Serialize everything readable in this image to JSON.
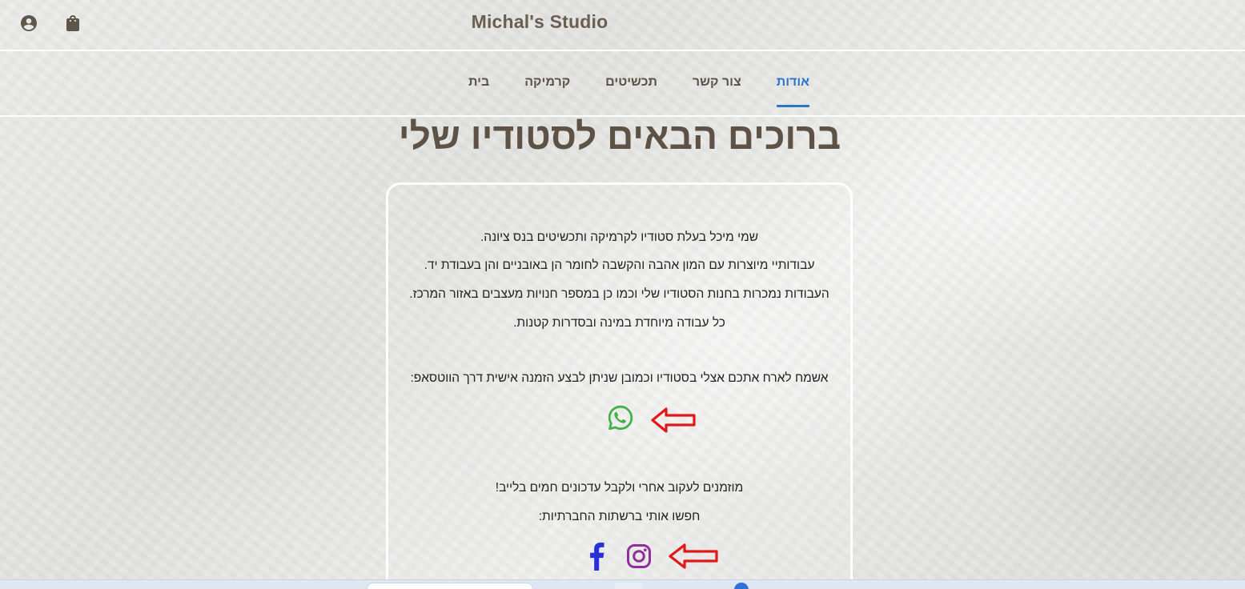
{
  "header": {
    "site_title": "Michal's Studio",
    "account_icon": "account-circle-icon",
    "cart_icon": "shopping-bag-icon"
  },
  "nav": {
    "items": [
      {
        "label": "בית",
        "active": false
      },
      {
        "label": "קרמיקה",
        "active": false
      },
      {
        "label": "תכשיטים",
        "active": false
      },
      {
        "label": "צור קשר",
        "active": false
      },
      {
        "label": "אודות",
        "active": true
      }
    ],
    "active_color": "#2e74c9"
  },
  "main": {
    "heading": "ברוכים הבאים לסטודיו שלי",
    "about_lines": [
      "שמי מיכל בעלת סטודיו לקרמיקה ותכשיטים בנס ציונה.",
      "עבודותיי מיוצרות עם המון אהבה והקשבה לחומר הן באובניים והן בעבודת יד.",
      "העבודות נמכרות בחנות הסטודיו שלי וכמו כן במספר חנויות מעצבים באזור המרכז.",
      "כל עבודה מיוחדת במינה ובסדרות קטנות."
    ],
    "invite_text": "אשמח לארח אתכם אצלי בסטודיו וכמובן שניתן לבצע הזמנה אישית דרך הווטסאפ:",
    "whatsapp_icon": "whatsapp-icon",
    "follow_lines": [
      "מוזמנים לעקוב אחרי ולקבל עדכונים חמים בלייב!",
      "חפשו אותי ברשתות החברתיות:"
    ],
    "social_icons": [
      "facebook-icon",
      "instagram-icon"
    ]
  },
  "colors": {
    "text_brown": "#5e5246",
    "whatsapp": "#43b14b",
    "facebook": "#2b2fd8",
    "instagram": "#8e2f9c",
    "annotation_arrow": "#e01818"
  }
}
